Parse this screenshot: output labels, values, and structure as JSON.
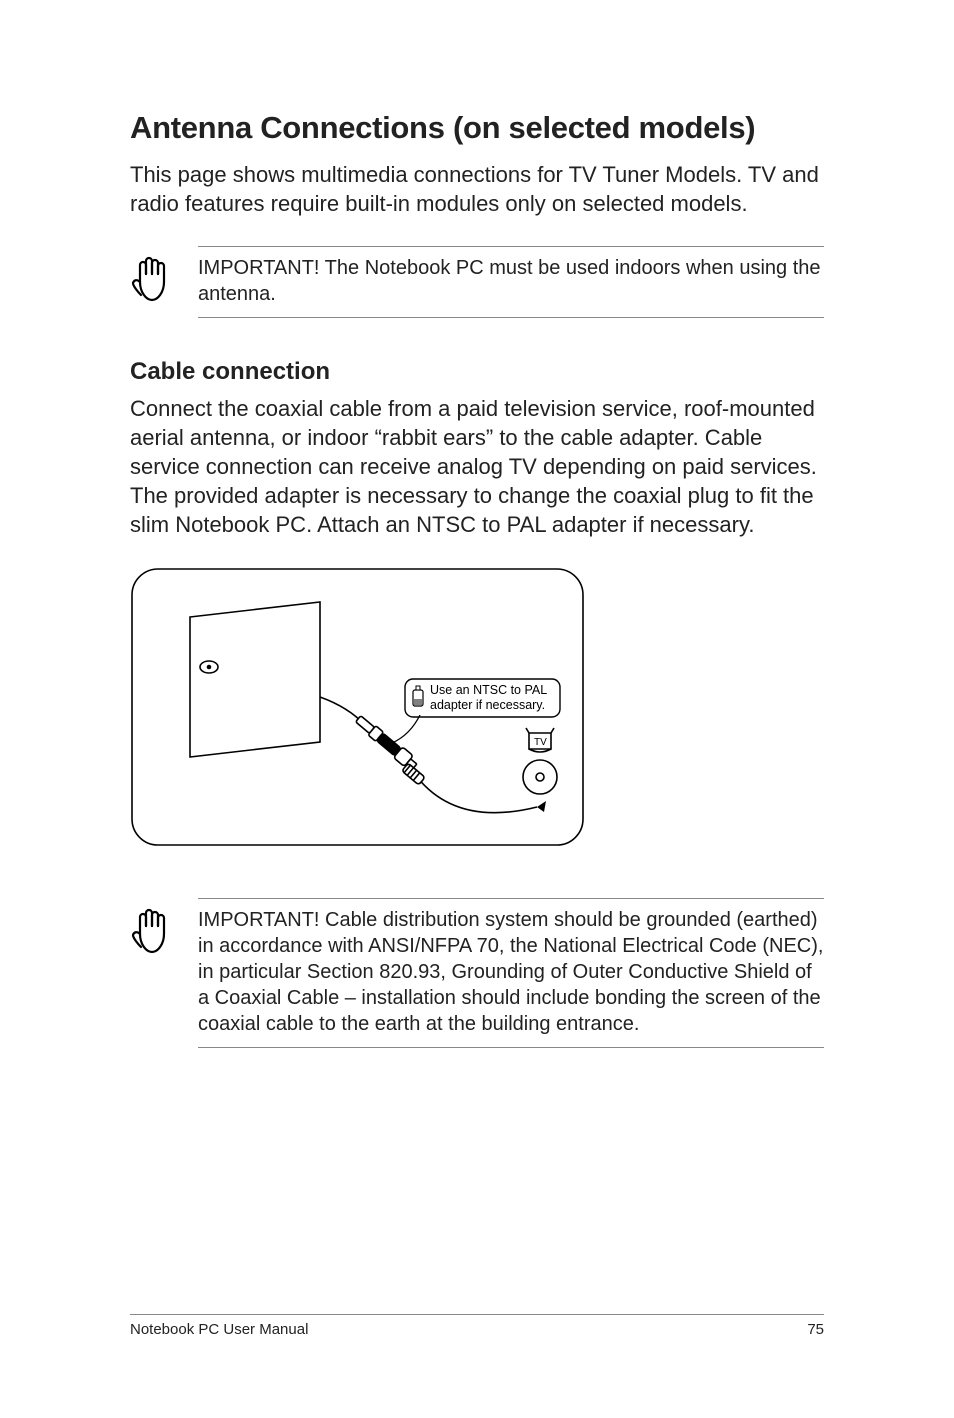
{
  "title": "Antenna Connections (on selected models)",
  "intro": "This page shows multimedia connections for TV Tuner Models. TV and radio features require built-in modules only on selected models.",
  "note1": "IMPORTANT! The Notebook PC must be used indoors when using the antenna.",
  "subhead": "Cable connection",
  "cable_body": "Connect the coaxial cable from a paid television service, roof-mounted aerial antenna, or indoor “rabbit ears” to the cable adapter. Cable service connection can receive analog TV depending on paid services. The provided adapter is necessary to change the coaxial plug to fit the slim Notebook PC. Attach an NTSC to PAL adapter if necessary.",
  "diagram": {
    "callout_line1": "Use an NTSC to PAL",
    "callout_line2": "adapter if necessary.",
    "tv_label": "TV"
  },
  "note2": "IMPORTANT!  Cable distribution system should be grounded (earthed) in accordance with ANSI/NFPA 70, the National Electrical Code (NEC), in particular Section 820.93, Grounding of Outer Conductive Shield of a Coaxial Cable – installation should include bonding the screen of the coaxial cable to the earth at the building entrance.",
  "footer_left": "Notebook PC User Manual",
  "footer_right": "75"
}
